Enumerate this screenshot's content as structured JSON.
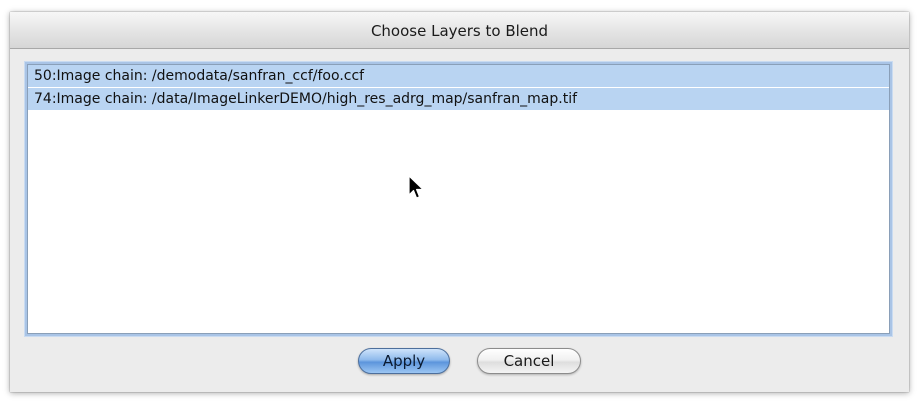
{
  "window": {
    "title": "Choose Layers to Blend"
  },
  "layers": {
    "items": [
      {
        "label": "50:Image chain: /demodata/sanfran_ccf/foo.ccf",
        "selected": true
      },
      {
        "label": "74:Image chain: /data/ImageLinkerDEMO/high_res_adrg_map/sanfran_map.tif",
        "selected": true
      }
    ]
  },
  "buttons": {
    "apply_label": "Apply",
    "cancel_label": "Cancel"
  },
  "colors": {
    "selection": "#b9d4f2",
    "default_button": "#5c95dc"
  }
}
